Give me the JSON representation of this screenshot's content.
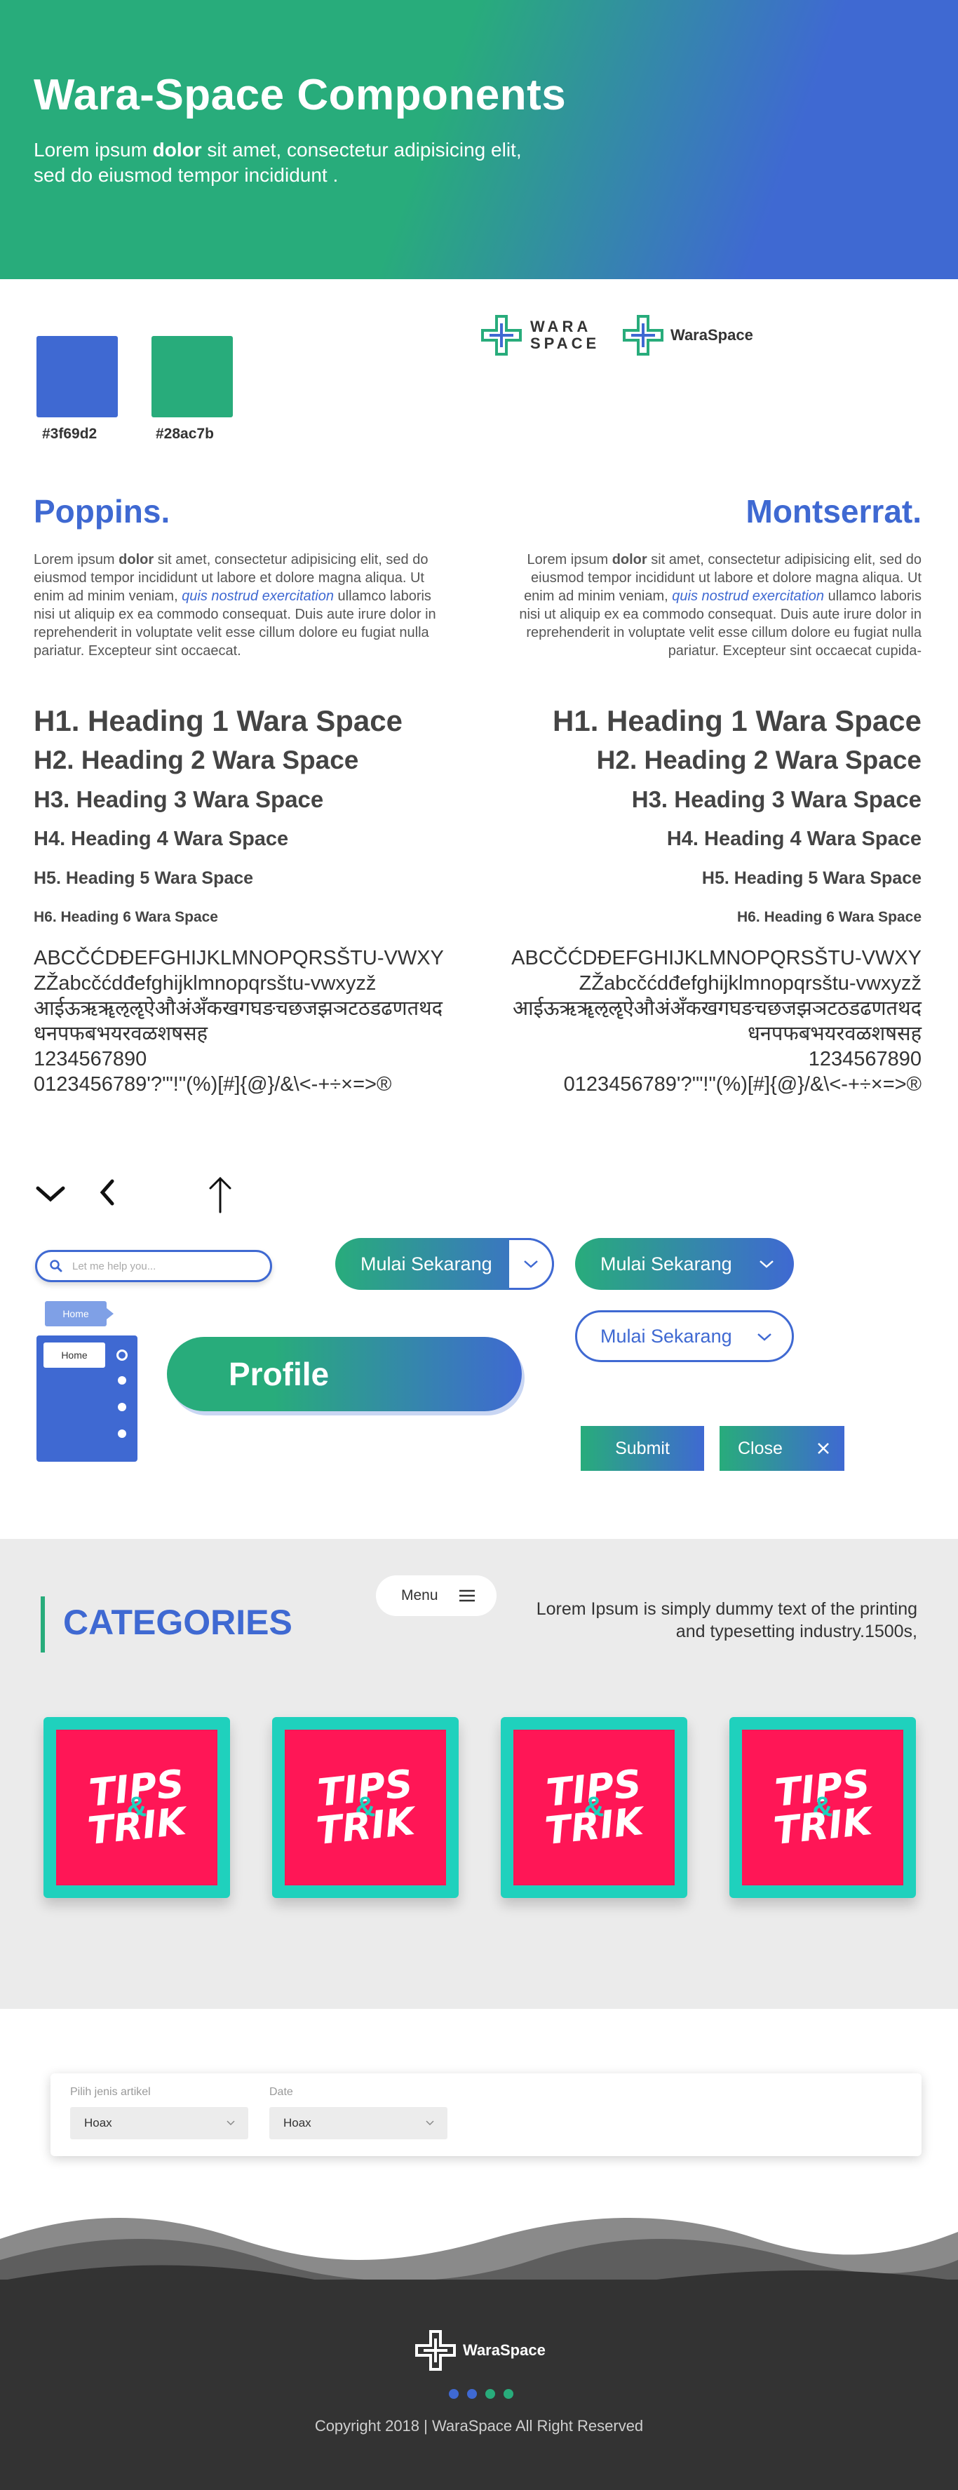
{
  "hero": {
    "title": "Wara-Space Components",
    "line1_pre": "Lorem ipsum ",
    "line1_bold": "dolor",
    "line1_post": " sit amet, consectetur adipisicing elit,",
    "line2": " sed do eiusmod tempor incididunt ."
  },
  "colors": {
    "primary": "#3f69d2",
    "secondary": "#28ac7b",
    "primary_label": "#3f69d2",
    "secondary_label": "#28ac7b"
  },
  "logos": {
    "stacked_line1": "WARA",
    "stacked_line2": "SPACE",
    "inline": "WaraSpace"
  },
  "typography": {
    "left_font": "Poppins.",
    "right_font": "Montserrat.",
    "lorem_pre": "Lorem ipsum ",
    "lorem_bold": "dolor",
    "lorem_mid": " sit amet, consectetur adipisicing elit, sed do eiusmod tempor incididunt ut labore et dolore magna aliqua. Ut enim ad minim veniam, ",
    "lorem_italic": "quis nostrud exercitation",
    "lorem_post_left": " ullamco laboris nisi ut aliquip ex ea commodo consequat. Duis aute irure dolor in reprehenderit in voluptate velit esse cillum dolore eu fugiat nulla pariatur. Excepteur sint occaecat.",
    "lorem_post_right": " ullamco laboris nisi ut aliquip ex ea commodo consequat. Duis aute irure dolor in reprehenderit in voluptate velit esse cillum dolore eu fugiat nulla pariatur. Excepteur sint occaecat cupida-",
    "headings": [
      "H1. Heading 1 Wara Space",
      "H2. Heading 2 Wara Space",
      "H3. Heading 3 Wara Space",
      "H4. Heading 4 Wara Space",
      "H5. Heading 5 Wara Space",
      "H6. Heading 6 Wara Space"
    ],
    "glyphs_latin": "ABCČĆDĐEFGHIJKLMNOPQRSŠTU-VWXYZŽabcčćdđefghijklmnopqrsštu-vwxyzž",
    "glyphs_latin_right": "ABCČĆDĐEFGHIJKLMNOPQRSŠTU-VWXYZŽabcčćdđefghijklmnopqrsštu-vwxyzž",
    "glyphs_deva": "आईऊऋॠऌॡऐऔअंअँकखगघङचछजझञटठडढणतथदधनपफबभयरवळशषसह",
    "glyphs_digits": "1234567890",
    "glyphs_symbols": "0123456789'?'\"!\"(%)[#]{@}/&\\<-+÷×=>®"
  },
  "controls": {
    "search_placeholder": "Let me help you...",
    "dropdown_label": "Mulai Sekarang",
    "home_tag": "Home",
    "home_item": "Home",
    "profile_label": "Profile",
    "submit_label": "Submit",
    "close_label": "Close"
  },
  "categories": {
    "menu_label": "Menu",
    "title": "CATEGORIES",
    "description": "Lorem Ipsum is simply dummy text of the printing and typesetting industry.1500s,",
    "cards": [
      {
        "line1": "TIPS",
        "amp": "&",
        "line2": "TRIK"
      },
      {
        "line1": "TIPS",
        "amp": "&",
        "line2": "TRIK"
      },
      {
        "line1": "TIPS",
        "amp": "&",
        "line2": "TRIK"
      },
      {
        "line1": "TIPS",
        "amp": "&",
        "line2": "TRIK"
      }
    ]
  },
  "filter": {
    "type_label": "Pilih jenis artikel",
    "type_value": "Hoax",
    "date_label": "Date",
    "date_value": "Hoax"
  },
  "footer": {
    "logo_text": "WaraSpace",
    "copyright": "Copyright 2018 | WaraSpace All Right Reserved",
    "dot_colors": [
      "#3f69d2",
      "#3f69d2",
      "#28ac7b",
      "#28ac7b"
    ]
  }
}
